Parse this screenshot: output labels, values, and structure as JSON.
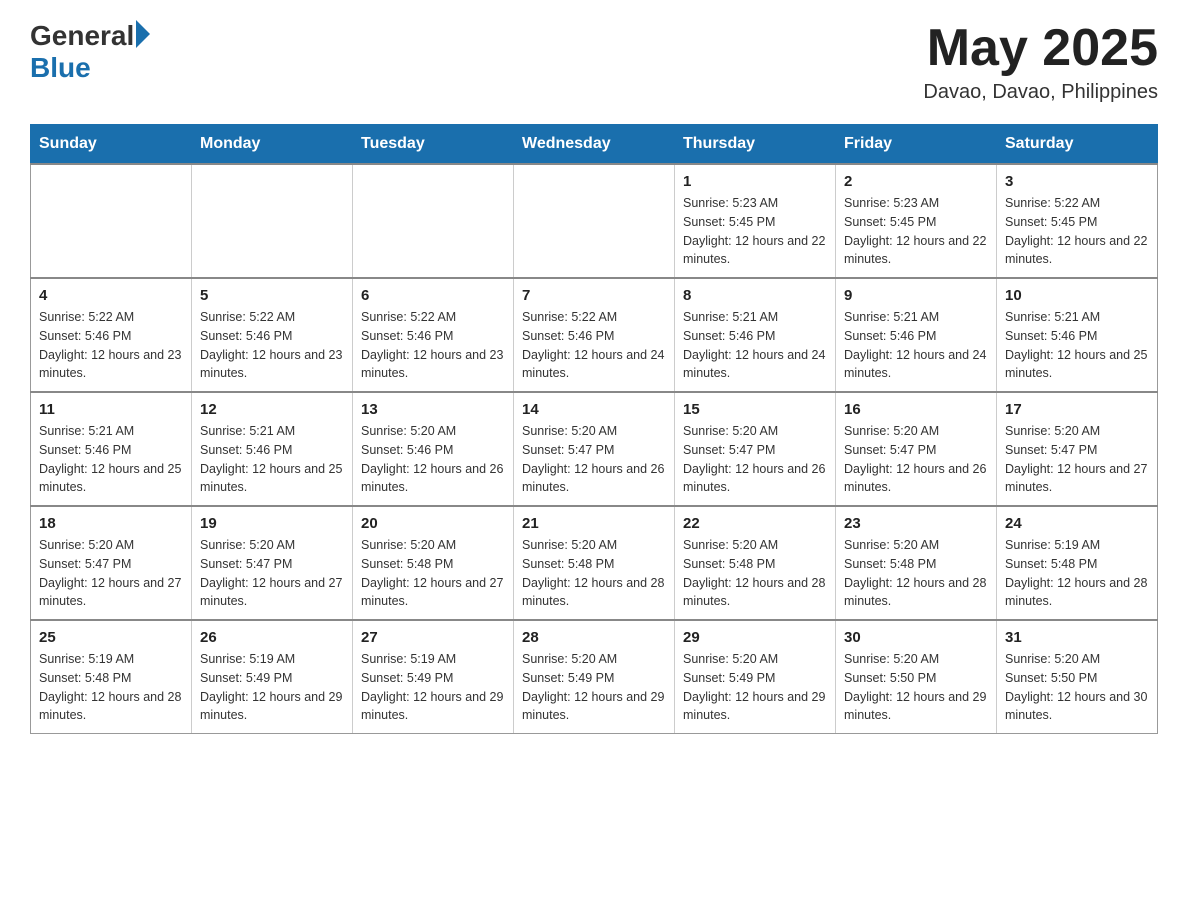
{
  "header": {
    "logo_general": "General",
    "logo_blue": "Blue",
    "month_year": "May 2025",
    "location": "Davao, Davao, Philippines"
  },
  "days_of_week": [
    "Sunday",
    "Monday",
    "Tuesday",
    "Wednesday",
    "Thursday",
    "Friday",
    "Saturday"
  ],
  "weeks": [
    [
      {
        "day": "",
        "info": ""
      },
      {
        "day": "",
        "info": ""
      },
      {
        "day": "",
        "info": ""
      },
      {
        "day": "",
        "info": ""
      },
      {
        "day": "1",
        "info": "Sunrise: 5:23 AM\nSunset: 5:45 PM\nDaylight: 12 hours and 22 minutes."
      },
      {
        "day": "2",
        "info": "Sunrise: 5:23 AM\nSunset: 5:45 PM\nDaylight: 12 hours and 22 minutes."
      },
      {
        "day": "3",
        "info": "Sunrise: 5:22 AM\nSunset: 5:45 PM\nDaylight: 12 hours and 22 minutes."
      }
    ],
    [
      {
        "day": "4",
        "info": "Sunrise: 5:22 AM\nSunset: 5:46 PM\nDaylight: 12 hours and 23 minutes."
      },
      {
        "day": "5",
        "info": "Sunrise: 5:22 AM\nSunset: 5:46 PM\nDaylight: 12 hours and 23 minutes."
      },
      {
        "day": "6",
        "info": "Sunrise: 5:22 AM\nSunset: 5:46 PM\nDaylight: 12 hours and 23 minutes."
      },
      {
        "day": "7",
        "info": "Sunrise: 5:22 AM\nSunset: 5:46 PM\nDaylight: 12 hours and 24 minutes."
      },
      {
        "day": "8",
        "info": "Sunrise: 5:21 AM\nSunset: 5:46 PM\nDaylight: 12 hours and 24 minutes."
      },
      {
        "day": "9",
        "info": "Sunrise: 5:21 AM\nSunset: 5:46 PM\nDaylight: 12 hours and 24 minutes."
      },
      {
        "day": "10",
        "info": "Sunrise: 5:21 AM\nSunset: 5:46 PM\nDaylight: 12 hours and 25 minutes."
      }
    ],
    [
      {
        "day": "11",
        "info": "Sunrise: 5:21 AM\nSunset: 5:46 PM\nDaylight: 12 hours and 25 minutes."
      },
      {
        "day": "12",
        "info": "Sunrise: 5:21 AM\nSunset: 5:46 PM\nDaylight: 12 hours and 25 minutes."
      },
      {
        "day": "13",
        "info": "Sunrise: 5:20 AM\nSunset: 5:46 PM\nDaylight: 12 hours and 26 minutes."
      },
      {
        "day": "14",
        "info": "Sunrise: 5:20 AM\nSunset: 5:47 PM\nDaylight: 12 hours and 26 minutes."
      },
      {
        "day": "15",
        "info": "Sunrise: 5:20 AM\nSunset: 5:47 PM\nDaylight: 12 hours and 26 minutes."
      },
      {
        "day": "16",
        "info": "Sunrise: 5:20 AM\nSunset: 5:47 PM\nDaylight: 12 hours and 26 minutes."
      },
      {
        "day": "17",
        "info": "Sunrise: 5:20 AM\nSunset: 5:47 PM\nDaylight: 12 hours and 27 minutes."
      }
    ],
    [
      {
        "day": "18",
        "info": "Sunrise: 5:20 AM\nSunset: 5:47 PM\nDaylight: 12 hours and 27 minutes."
      },
      {
        "day": "19",
        "info": "Sunrise: 5:20 AM\nSunset: 5:47 PM\nDaylight: 12 hours and 27 minutes."
      },
      {
        "day": "20",
        "info": "Sunrise: 5:20 AM\nSunset: 5:48 PM\nDaylight: 12 hours and 27 minutes."
      },
      {
        "day": "21",
        "info": "Sunrise: 5:20 AM\nSunset: 5:48 PM\nDaylight: 12 hours and 28 minutes."
      },
      {
        "day": "22",
        "info": "Sunrise: 5:20 AM\nSunset: 5:48 PM\nDaylight: 12 hours and 28 minutes."
      },
      {
        "day": "23",
        "info": "Sunrise: 5:20 AM\nSunset: 5:48 PM\nDaylight: 12 hours and 28 minutes."
      },
      {
        "day": "24",
        "info": "Sunrise: 5:19 AM\nSunset: 5:48 PM\nDaylight: 12 hours and 28 minutes."
      }
    ],
    [
      {
        "day": "25",
        "info": "Sunrise: 5:19 AM\nSunset: 5:48 PM\nDaylight: 12 hours and 28 minutes."
      },
      {
        "day": "26",
        "info": "Sunrise: 5:19 AM\nSunset: 5:49 PM\nDaylight: 12 hours and 29 minutes."
      },
      {
        "day": "27",
        "info": "Sunrise: 5:19 AM\nSunset: 5:49 PM\nDaylight: 12 hours and 29 minutes."
      },
      {
        "day": "28",
        "info": "Sunrise: 5:20 AM\nSunset: 5:49 PM\nDaylight: 12 hours and 29 minutes."
      },
      {
        "day": "29",
        "info": "Sunrise: 5:20 AM\nSunset: 5:49 PM\nDaylight: 12 hours and 29 minutes."
      },
      {
        "day": "30",
        "info": "Sunrise: 5:20 AM\nSunset: 5:50 PM\nDaylight: 12 hours and 29 minutes."
      },
      {
        "day": "31",
        "info": "Sunrise: 5:20 AM\nSunset: 5:50 PM\nDaylight: 12 hours and 30 minutes."
      }
    ]
  ]
}
